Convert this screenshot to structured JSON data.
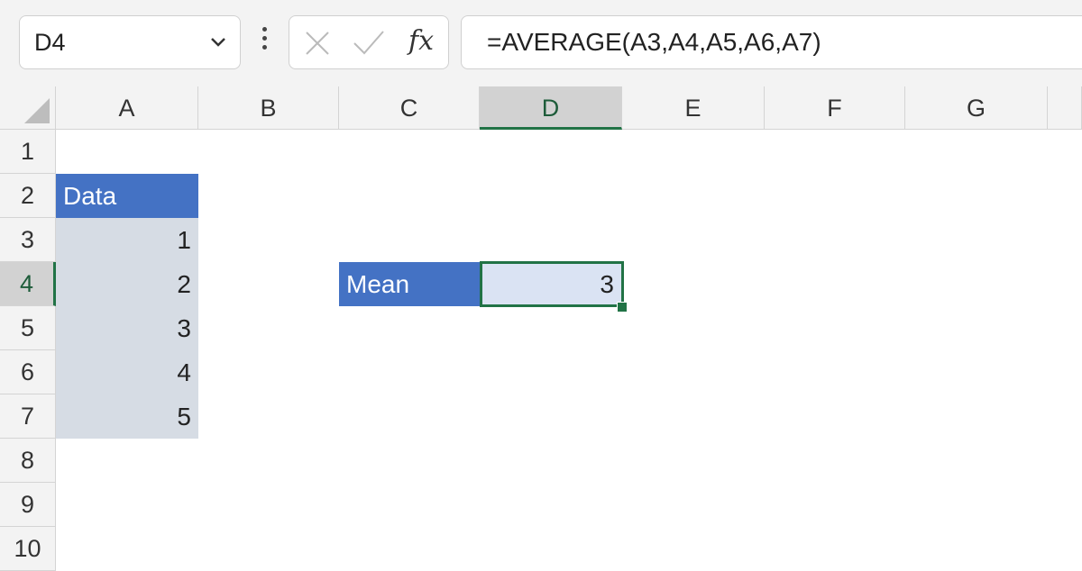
{
  "formula_bar": {
    "name_box": "D4",
    "formula": "=AVERAGE(A3,A4,A5,A6,A7)",
    "fx_label": "fx"
  },
  "columns": [
    "A",
    "B",
    "C",
    "D",
    "E",
    "F",
    "G"
  ],
  "rows": [
    "1",
    "2",
    "3",
    "4",
    "5",
    "6",
    "7",
    "8",
    "9",
    "10"
  ],
  "selection": {
    "column": "D",
    "row": "4"
  },
  "cells": {
    "A2": "Data",
    "A3": "1",
    "A4": "2",
    "A5": "3",
    "A6": "4",
    "A7": "5",
    "C4": "Mean",
    "D4": "3"
  },
  "colors": {
    "header_fill": "#4472c4",
    "data_fill": "#d6dce4",
    "active_fill": "#dae3f3",
    "selection_accent": "#217346"
  }
}
